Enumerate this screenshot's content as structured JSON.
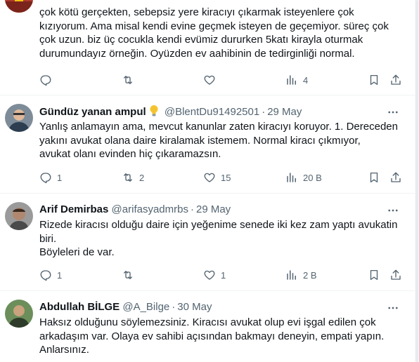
{
  "tweets": [
    {
      "name": "",
      "handle": "",
      "date": "",
      "text_lines": [
        "çok kötü gerçekten, sebepsiz yere kiracıyı çıkarmak isteyenlere çok",
        "kızıyorum. Ama misal kendi evine geçmek isteyen de geçemiyor. süreç çok",
        "çok uzun. biz üç cocukla kendi evümiz dururken 5katı kirayla oturmak",
        "durumundayız örneğin. Oyüzden ev aahibinin de tedirginliği normal."
      ],
      "replies": "",
      "retweets": "",
      "likes": "",
      "views": "4"
    },
    {
      "name": "Gündüz yanan ampul",
      "handle": "@BlentDu91492501",
      "date": "29 May",
      "text_lines": [
        "Yanlış anlamayın ama, mevcut kanunlar zaten kiracıyı koruyor. 1. Dereceden",
        "yakını avukat olana daire kiralamak  istemem. Normal kiracı çıkmıyor,",
        "avukat olanı evinden hiç çıkaramazsın."
      ],
      "replies": "1",
      "retweets": "2",
      "likes": "15",
      "views": "20 B"
    },
    {
      "name": "Arif Demirbas",
      "handle": "@arifasyadmrbs",
      "date": "29 May",
      "text_lines": [
        "Rizede kiracısı olduğu daire için yeğenime senede iki kez zam yaptı avukatin",
        "biri.",
        "Böyleleri de var."
      ],
      "replies": "1",
      "retweets": "",
      "likes": "1",
      "views": "2 B"
    },
    {
      "name": "Abdullah BİLGE",
      "handle": "@A_Bilge",
      "date": "30 May",
      "text_lines": [
        "Haksız olduğunu söylemezsiniz. Kiracısı avukat olup evi işgal edilen çok",
        "arkadaşım var. Olaya ev sahibi açısından bakmayı deneyin, empati yapın.",
        "Anlarsınız."
      ]
    }
  ],
  "icons": {
    "reply": "reply-icon",
    "retweet": "retweet-icon",
    "like": "heart-icon",
    "views": "views-chart-icon",
    "bookmark": "bookmark-icon",
    "share": "share-icon",
    "more": "more-horizontal-icon",
    "bulb": "lightbulb-emoji-icon"
  },
  "colors": {
    "text": "#0f1419",
    "secondary": "#536471",
    "divider": "#eff3f4",
    "bulb": "#f4c430"
  }
}
